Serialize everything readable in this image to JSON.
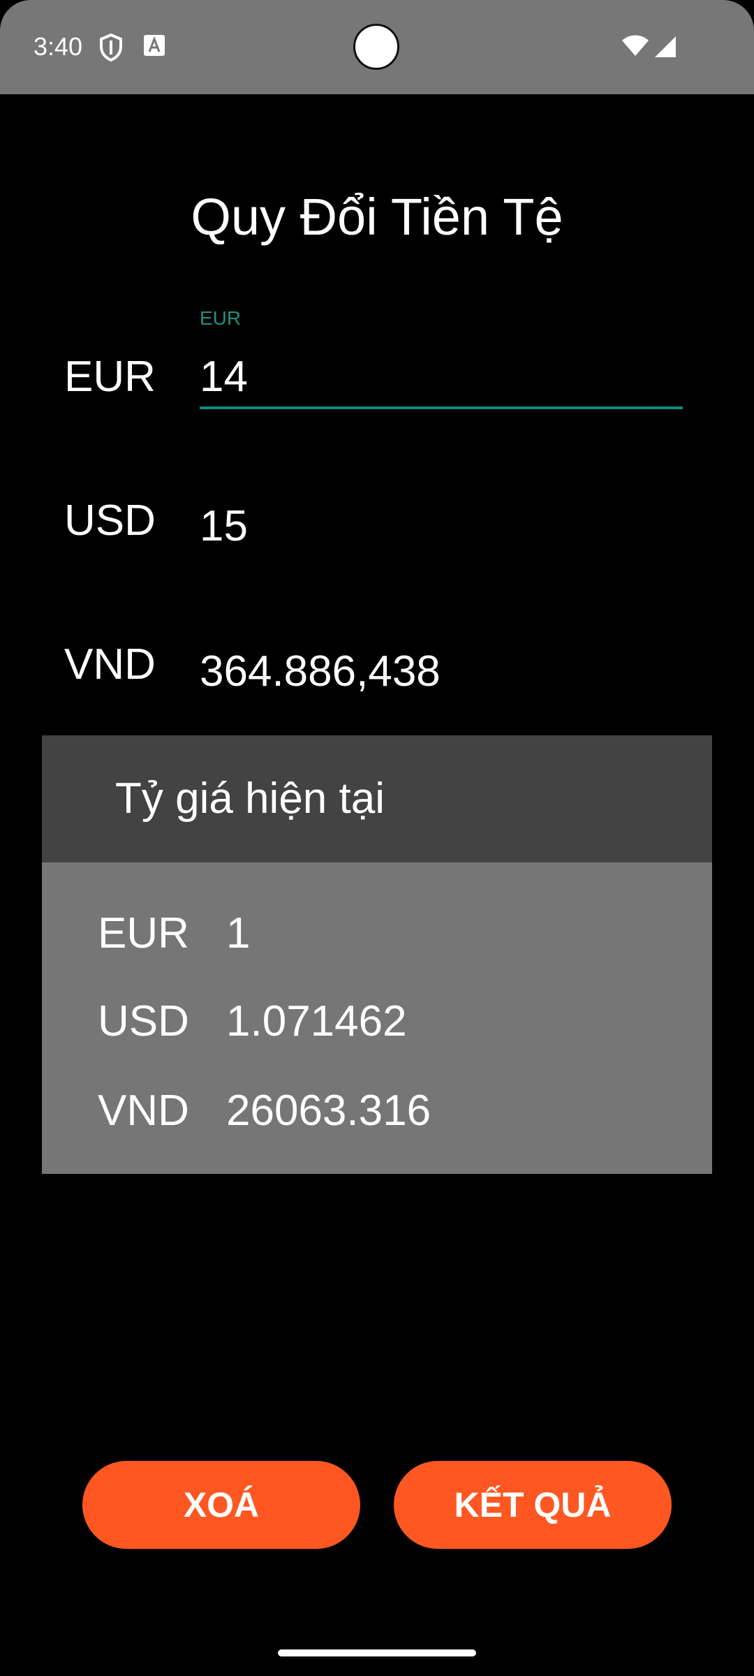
{
  "status_bar": {
    "time": "3:40",
    "icons": [
      "shield-icon",
      "a-icon",
      "wifi-icon",
      "signal-icon"
    ]
  },
  "app": {
    "title": "Quy Đổi Tiền Tệ"
  },
  "converter": {
    "eur": {
      "label": "EUR",
      "input_hint": "EUR",
      "value": "14"
    },
    "usd": {
      "label": "USD",
      "value": "15"
    },
    "vnd": {
      "label": "VND",
      "value": "364.886,438"
    }
  },
  "rates": {
    "title": "Tỷ giá hiện tại",
    "items": [
      {
        "code": "EUR",
        "value": "1"
      },
      {
        "code": "USD",
        "value": "1.071462"
      },
      {
        "code": "VND",
        "value": "26063.316"
      }
    ]
  },
  "buttons": {
    "clear": "XOÁ",
    "result": "KẾT QUẢ"
  },
  "colors": {
    "accent": "#ff5722",
    "input_underline": "#0f8a7c",
    "status_bar": "#777777",
    "rates_header": "#434343",
    "rates_body": "#767676"
  }
}
